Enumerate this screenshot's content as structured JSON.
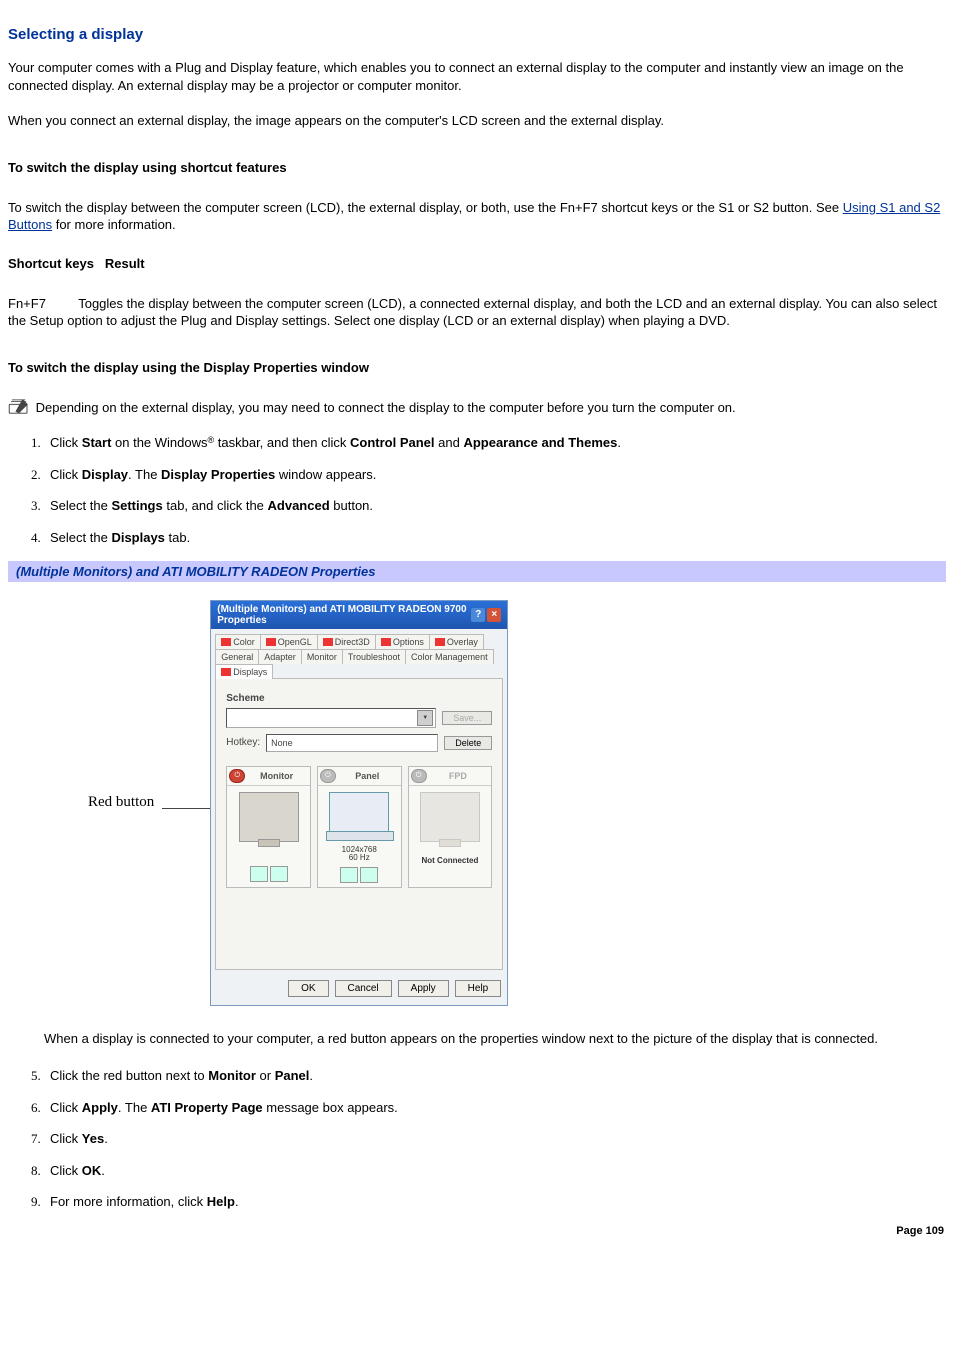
{
  "title": "Selecting a display",
  "intro1": "Your computer comes with a Plug and Display feature, which enables you to connect an external display to the computer and instantly view an image on the connected display. An external display may be a projector or computer monitor.",
  "intro2": "When you connect an external display, the image appears on the computer's LCD screen and the external display.",
  "shortcut_heading": "To switch the display using shortcut features",
  "shortcut_body_pre": "To switch the display between the computer screen (LCD), the external display, or both, use the Fn+F7 shortcut keys or the S1 or S2 button. See ",
  "shortcut_link": "Using S1 and S2 Buttons",
  "shortcut_body_post": " for more information.",
  "table": {
    "col1": "Shortcut keys",
    "col2": "Result",
    "key": "Fn+F7",
    "result": "Toggles the display between the computer screen (LCD), a connected external display, and both the LCD and an external display. You can also select the Setup option to adjust the Plug and Display settings. Select one display (LCD or an external display) when playing a DVD."
  },
  "props_heading": "To switch the display using the Display Properties window",
  "note": " Depending on the external display, you may need to connect the display to the computer before you turn the computer on.",
  "steps_a": [
    {
      "pre": "Click ",
      "b1": "Start",
      "mid1": " on the Windows",
      "reg": "®",
      "mid2": " taskbar, and then click ",
      "b2": "Control Panel",
      "mid3": " and ",
      "b3": "Appearance and Themes",
      "end": "."
    },
    {
      "pre": "Click ",
      "b1": "Display",
      "mid1": ". The ",
      "b2": "Display Properties",
      "end": " window appears."
    },
    {
      "pre": "Select the ",
      "b1": "Settings",
      "mid1": " tab, and click the ",
      "b2": "Advanced",
      "end": " button."
    },
    {
      "pre": "Select the ",
      "b1": "Displays",
      "end": " tab."
    }
  ],
  "caption": "(Multiple Monitors) and ATI MOBILITY RADEON Properties",
  "callout": "Red button",
  "dialog": {
    "title": "(Multiple Monitors) and ATI MOBILITY RADEON 9700 Properties",
    "tabs_row1": [
      "Color",
      "OpenGL",
      "Direct3D",
      "Options",
      "Overlay"
    ],
    "tabs_row2": [
      "General",
      "Adapter",
      "Monitor",
      "Troubleshoot",
      "Color Management",
      "Displays"
    ],
    "scheme_label": "Scheme",
    "hotkey_label": "Hotkey:",
    "hotkey_value": "None",
    "save_btn": "Save...",
    "delete_btn": "Delete",
    "cards": {
      "monitor": "Monitor",
      "panel": "Panel",
      "fpd": "FPD",
      "res": "1024x768",
      "hz": "60 Hz",
      "not_connected": "Not Connected"
    },
    "buttons": [
      "OK",
      "Cancel",
      "Apply",
      "Help"
    ]
  },
  "after_dialog": "When a display is connected to your computer, a red button appears on the properties window next to the picture of the display that is connected.",
  "steps_b": [
    {
      "pre": "Click the red button next to ",
      "b1": "Monitor",
      "mid1": " or ",
      "b2": "Panel",
      "end": "."
    },
    {
      "pre": "Click ",
      "b1": "Apply",
      "mid1": ". The ",
      "b2": "ATI Property Page",
      "end": " message box appears."
    },
    {
      "pre": "Click ",
      "b1": "Yes",
      "end": "."
    },
    {
      "pre": "Click ",
      "b1": "OK",
      "end": "."
    },
    {
      "pre": "For more information, click ",
      "b1": "Help",
      "end": "."
    }
  ],
  "page_number": "Page 109"
}
